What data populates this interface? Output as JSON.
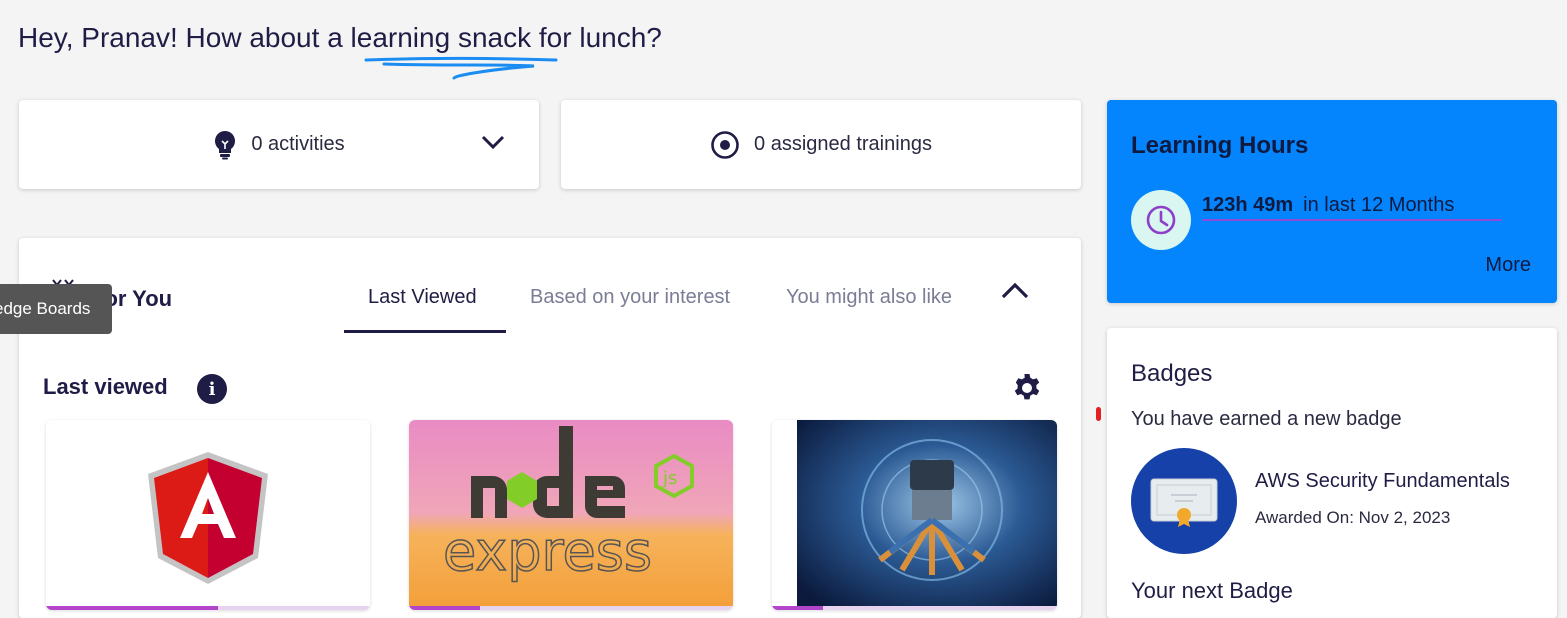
{
  "greeting": {
    "prefix": "Hey, Pranav! How about a ",
    "highlight": "learning snack",
    "suffix": " for lunch?"
  },
  "stats": {
    "activities": "0 activities",
    "assigned": "0 assigned trainings"
  },
  "learning_hours": {
    "title": "Learning Hours",
    "value": "123h 49m",
    "period": "in last 12 Months",
    "more": "More"
  },
  "badges": {
    "title": "Badges",
    "subtitle": "You have earned a new badge",
    "badge_name": "AWS Security Fundamentals",
    "awarded": "Awarded On: Nov 2, 2023",
    "next": "Your next Badge"
  },
  "for_you": {
    "title": "For You",
    "tabs": [
      "Last Viewed",
      "Based on your interest",
      "You might also like"
    ],
    "active_tab": "Last Viewed",
    "section_title": "Last viewed",
    "tiles": [
      {
        "name": "angular-course",
        "progress": 0.53
      },
      {
        "name": "node-express-course",
        "progress": 0.22
      },
      {
        "name": "aws-course",
        "progress": 0.18
      }
    ]
  },
  "tooltip": "edge Boards",
  "colors": {
    "accent": "#0585fd",
    "navy": "#1f1d45",
    "badge_blue": "#1541a8",
    "progress": "#b245c9"
  }
}
